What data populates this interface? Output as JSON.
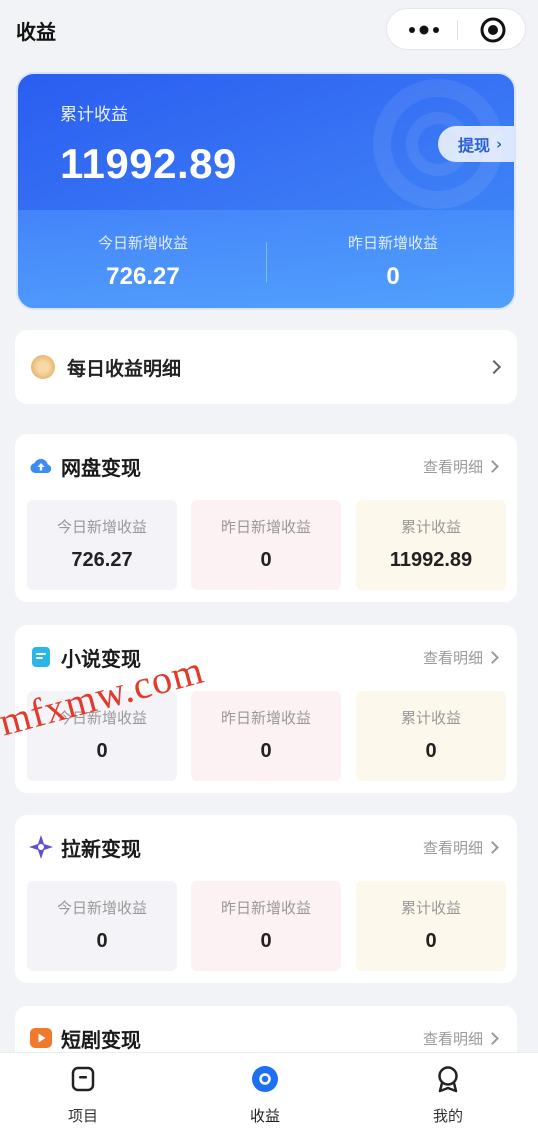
{
  "header": {
    "title": "收益"
  },
  "summary": {
    "cumulative_label": "累计收益",
    "cumulative_value": "11992.89",
    "withdraw_label": "提现",
    "today_label": "今日新增收益",
    "today_value": "726.27",
    "yesterday_label": "昨日新增收益",
    "yesterday_value": "0"
  },
  "daily": {
    "label": "每日收益明细"
  },
  "sections": [
    {
      "title": "网盘变现",
      "more": "查看明细",
      "icon": "cloud-icon",
      "stats": [
        {
          "label": "今日新增收益",
          "value": "726.27"
        },
        {
          "label": "昨日新增收益",
          "value": "0"
        },
        {
          "label": "累计收益",
          "value": "11992.89"
        }
      ]
    },
    {
      "title": "小说变现",
      "more": "查看明细",
      "icon": "book-icon",
      "stats": [
        {
          "label": "今日新增收益",
          "value": "0"
        },
        {
          "label": "昨日新增收益",
          "value": "0"
        },
        {
          "label": "累计收益",
          "value": "0"
        }
      ]
    },
    {
      "title": "拉新变现",
      "more": "查看明细",
      "icon": "sparkle-icon",
      "stats": [
        {
          "label": "今日新增收益",
          "value": "0"
        },
        {
          "label": "昨日新增收益",
          "value": "0"
        },
        {
          "label": "累计收益",
          "value": "0"
        }
      ]
    },
    {
      "title": "短剧变现",
      "more": "查看明细",
      "icon": "play-icon"
    }
  ],
  "watermark": "mfxmw.com",
  "tabbar": [
    {
      "label": "项目",
      "icon": "project-icon",
      "active": false
    },
    {
      "label": "收益",
      "icon": "income-icon",
      "active": true
    },
    {
      "label": "我的",
      "icon": "profile-icon",
      "active": false
    }
  ],
  "colors": {
    "primary": "#2a5df0",
    "accent_blue": "#1f6ff2"
  }
}
